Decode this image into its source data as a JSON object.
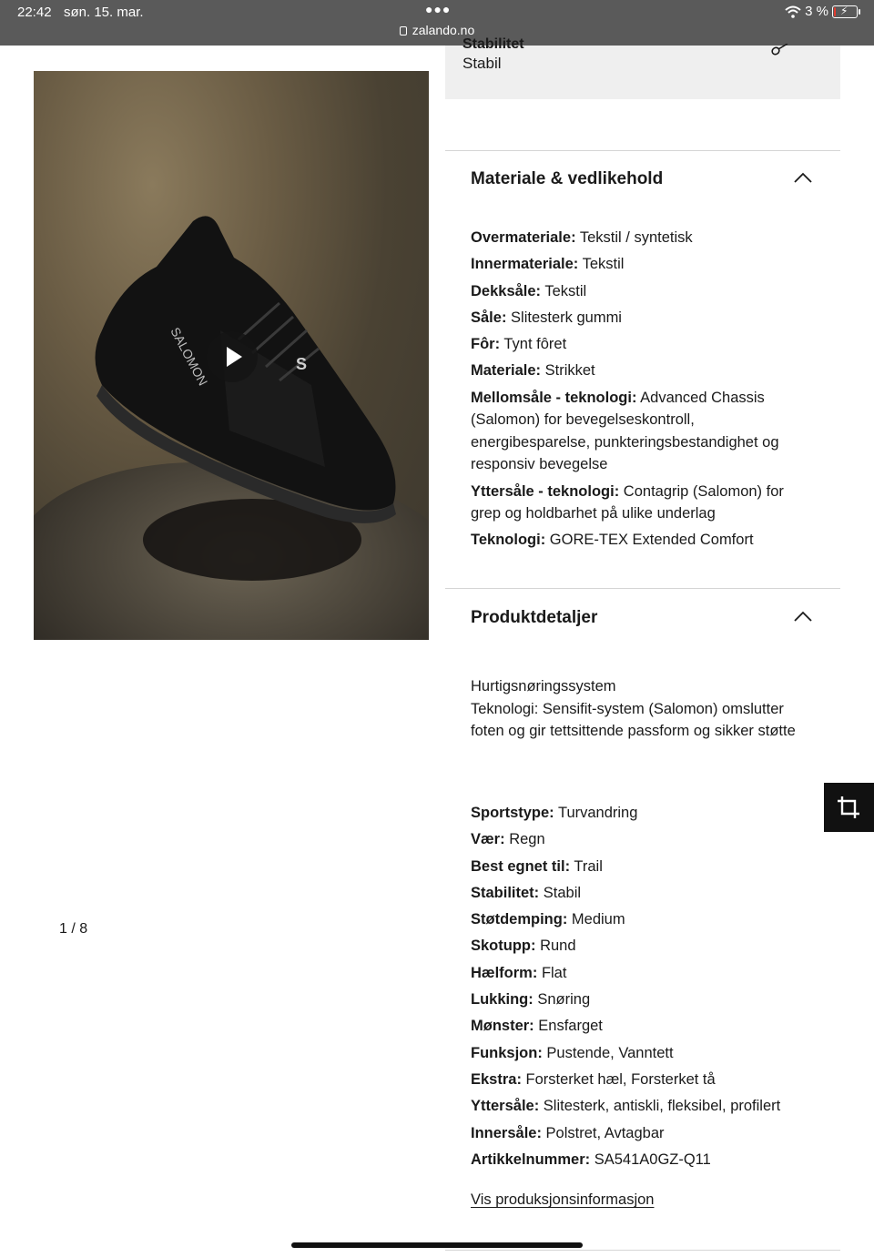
{
  "status_bar": {
    "time": "22:42",
    "date": "søn. 15. mar.",
    "url": "zalando.no",
    "battery": "3 %",
    "battery_fraction": 0.03
  },
  "gallery": {
    "pager": "1 / 8",
    "brand_text": "SALOMON",
    "play_icon": "play-icon"
  },
  "stability_card": {
    "label": "Stabilitet",
    "value": "Stabil",
    "icon": "info-icon"
  },
  "material_section": {
    "title": "Materiale & vedlikehold",
    "rows": [
      {
        "k": "Overmateriale:",
        "v": "Tekstil / syntetisk"
      },
      {
        "k": "Innermateriale:",
        "v": "Tekstil"
      },
      {
        "k": "Dekksåle:",
        "v": "Tekstil"
      },
      {
        "k": "Såle:",
        "v": "Slitesterk gummi"
      },
      {
        "k": "Fôr:",
        "v": "Tynt fôret"
      },
      {
        "k": "Materiale:",
        "v": "Strikket"
      },
      {
        "k": "Mellomsåle - teknologi:",
        "v": "Advanced Chassis (Salomon) for bevegelseskontroll, energibesparelse, punkteringsbestandighet og responsiv bevegelse"
      },
      {
        "k": "Yttersåle - teknologi:",
        "v": "Contagrip (Salomon) for grep og holdbarhet på ulike underlag"
      },
      {
        "k": "Teknologi:",
        "v": "GORE-TEX Extended Comfort"
      }
    ]
  },
  "details_section": {
    "title": "Produktdetaljer",
    "description_1": "Hurtigsnøringssystem",
    "description_2": "Teknologi: Sensifit-system (Salomon) omslutter foten og gir tettsittende passform og sikker støtte",
    "rows": [
      {
        "k": "Sportstype:",
        "v": "Turvandring"
      },
      {
        "k": "Vær:",
        "v": "Regn"
      },
      {
        "k": "Best egnet til:",
        "v": "Trail"
      },
      {
        "k": "Stabilitet:",
        "v": "Stabil"
      },
      {
        "k": "Støtdemping:",
        "v": "Medium"
      },
      {
        "k": "Skotupp:",
        "v": "Rund"
      },
      {
        "k": "Hælform:",
        "v": "Flat"
      },
      {
        "k": "Lukking:",
        "v": "Snøring"
      },
      {
        "k": "Mønster:",
        "v": "Ensfarget"
      },
      {
        "k": "Funksjon:",
        "v": "Pustende, Vanntett"
      },
      {
        "k": "Ekstra:",
        "v": "Forsterket hæl, Forsterket tå"
      },
      {
        "k": "Yttersåle:",
        "v": "Slitesterk, antiskli, fleksibel, profilert"
      },
      {
        "k": "Innersåle:",
        "v": "Polstret, Avtagbar"
      },
      {
        "k": "Artikkelnummer:",
        "v": "SA541A0GZ-Q11"
      }
    ],
    "link": "Vis produksjonsinformasjon"
  },
  "floating_button_icon": "crop-icon"
}
